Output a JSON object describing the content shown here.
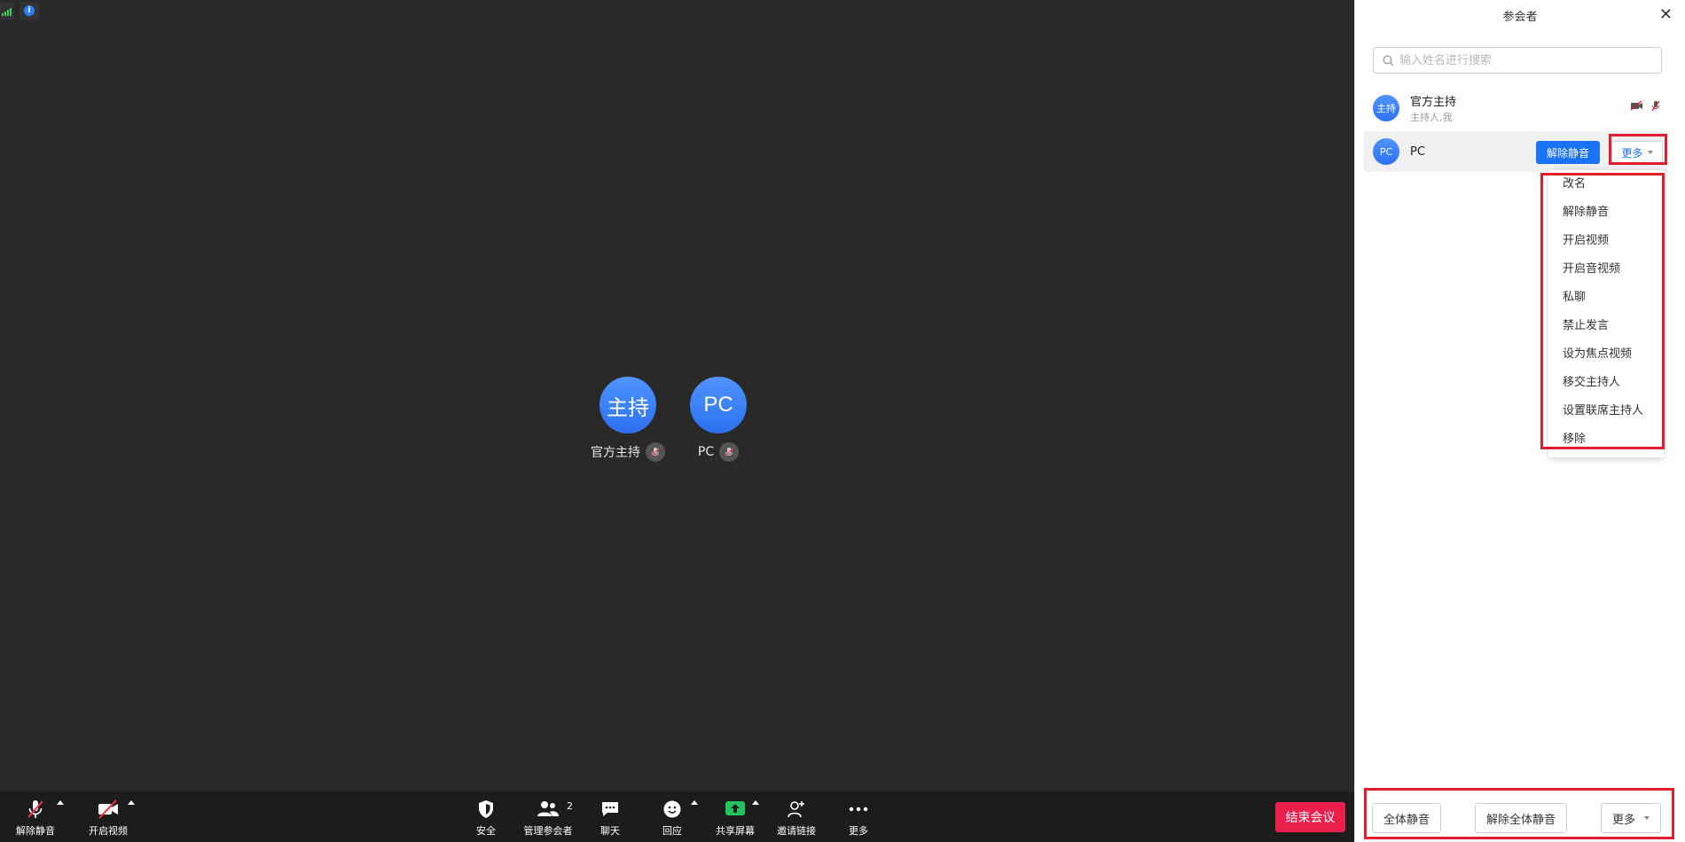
{
  "stage": {
    "tiles": [
      {
        "avatar": "主持",
        "name": "官方主持"
      },
      {
        "avatar": "PC",
        "name": "PC"
      }
    ]
  },
  "toolbar": {
    "unmute": "解除静音",
    "start_video": "开启视频",
    "security": "安全",
    "participants": "管理参会者",
    "participants_count": "2",
    "chat": "聊天",
    "reactions": "回应",
    "share_screen": "共享屏幕",
    "invite": "邀请链接",
    "more": "更多",
    "end_meeting": "结束会议"
  },
  "panel": {
    "title": "参会者",
    "search_placeholder": "输入姓名进行搜索",
    "participants": [
      {
        "avatar": "主持",
        "name": "官方主持",
        "role": "主持人,我"
      },
      {
        "avatar": "PC",
        "name": "PC"
      }
    ],
    "unmute_button": "解除静音",
    "more_button": "更多",
    "menu": [
      "改名",
      "解除静音",
      "开启视频",
      "开启音视频",
      "私聊",
      "禁止发言",
      "设为焦点视频",
      "移交主持人",
      "设置联席主持人",
      "移除"
    ],
    "footer": {
      "mute_all": "全体静音",
      "unmute_all": "解除全体静音",
      "more": "更多"
    }
  },
  "colors": {
    "accent": "#1a73f5",
    "end_meeting": "#ea1f4c",
    "highlight": "#e01e2d",
    "share_green": "#23c45e"
  }
}
